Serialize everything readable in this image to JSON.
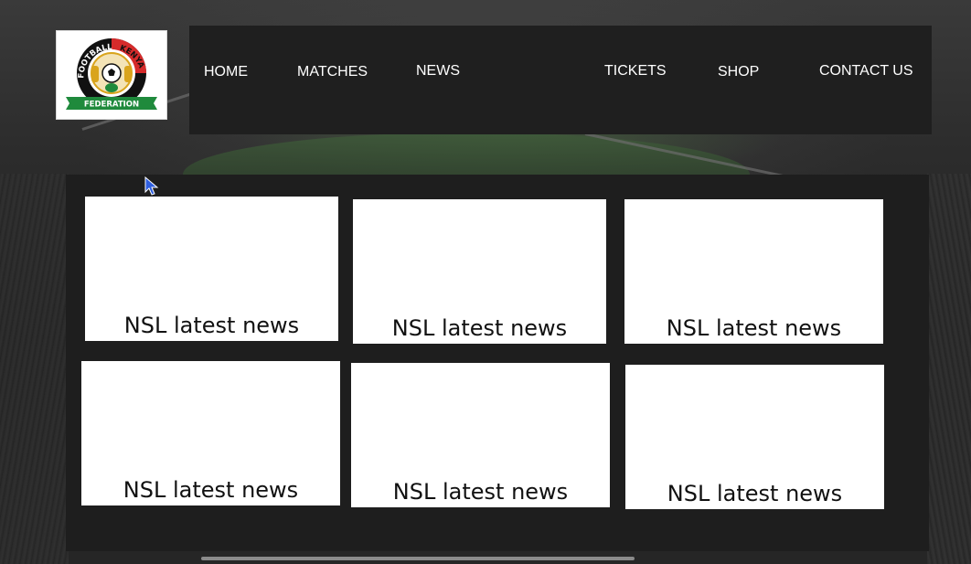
{
  "logo": {
    "icon": "football-kenya-federation-logo",
    "arc_text_left": "FOOTBALL",
    "arc_text_right": "KENYA",
    "banner_text": "FEDERATION",
    "colors": {
      "red": "#d62b2b",
      "green": "#1f8a3c",
      "black": "#111111",
      "gold": "#d9a41c"
    }
  },
  "nav": {
    "items": [
      "HOME",
      "MATCHES",
      "NEWS",
      "TICKETS",
      "SHOP",
      "CONTACT US"
    ]
  },
  "news": {
    "cards": [
      {
        "label": "NSL latest news"
      },
      {
        "label": "NSL latest news"
      },
      {
        "label": "NSL latest news"
      },
      {
        "label": "NSL latest news"
      },
      {
        "label": "NSL latest news"
      },
      {
        "label": "NSL latest news"
      }
    ]
  },
  "colors": {
    "nav_background": "#1f1f1f",
    "panel_background": "#1e1e1e",
    "card_background": "#ffffff",
    "nav_text": "#ffffff"
  }
}
